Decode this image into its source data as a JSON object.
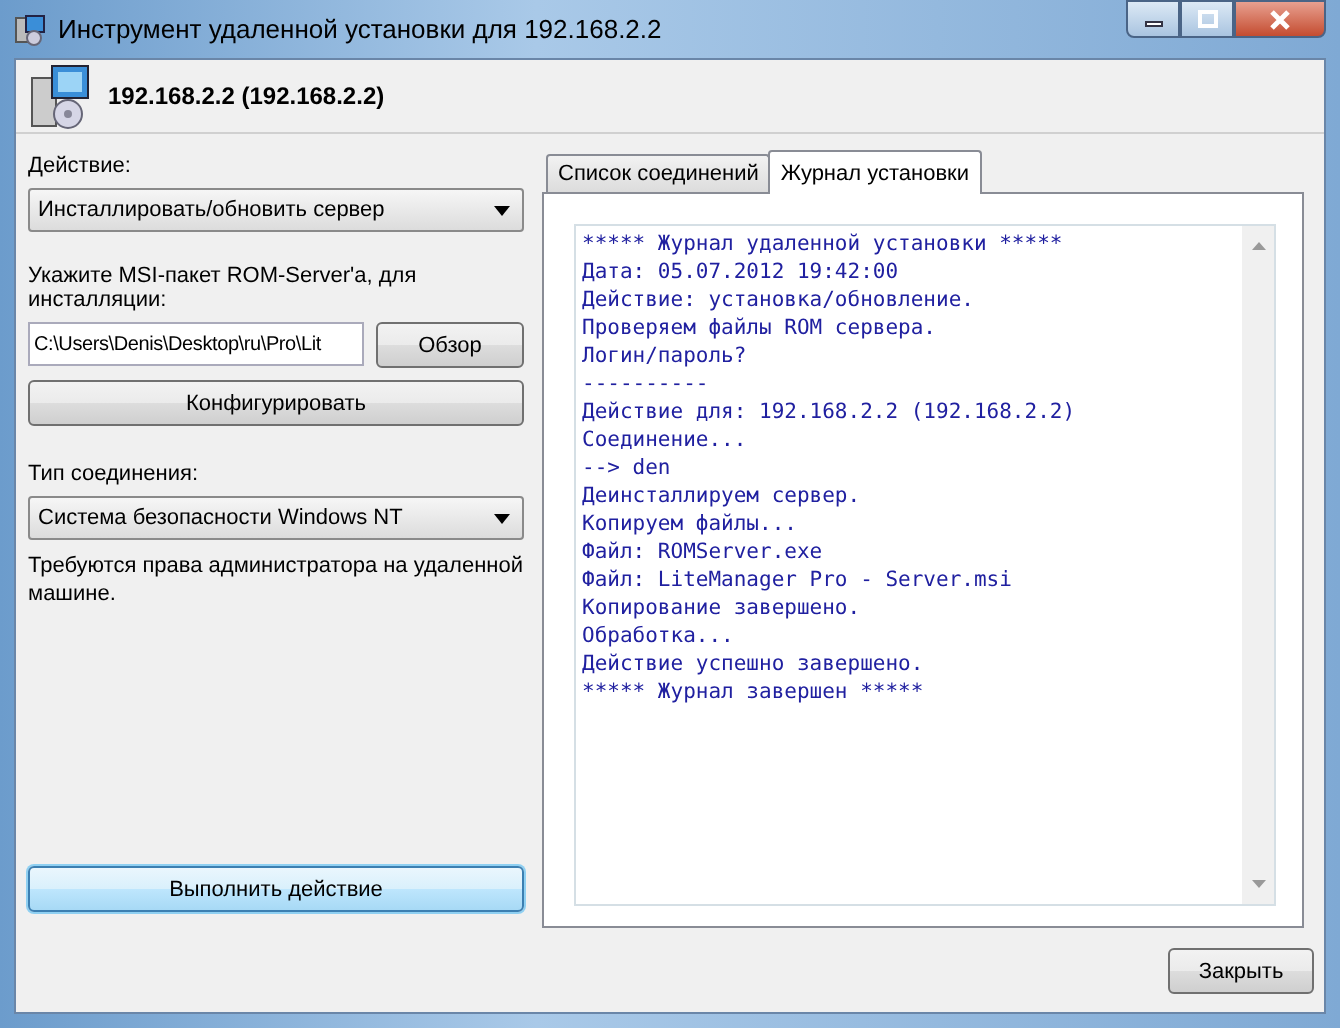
{
  "window": {
    "title": "Инструмент удаленной установки для 192.168.2.2"
  },
  "header": {
    "host": "192.168.2.2 (192.168.2.2)"
  },
  "action": {
    "label": "Действие:",
    "value": "Инсталлировать/обновить сервер"
  },
  "msi": {
    "label": "Укажите MSI-пакет ROM-Server'а, для инсталляции:",
    "path": "C:\\Users\\Denis\\Desktop\\ru\\Pro\\Lit",
    "browse": "Обзор"
  },
  "configure": "Конфигурировать",
  "connection": {
    "label": "Тип соединения:",
    "value": "Система безопасности Windows NT",
    "note": "Требуются права администратора на удаленной машине."
  },
  "run": {
    "label": "Выполнить действие",
    "focused": true
  },
  "tabs": [
    {
      "label": "Список соединений",
      "selected": false
    },
    {
      "label": "Журнал установки",
      "selected": true
    }
  ],
  "log": [
    "***** Журнал удаленной установки *****",
    "Дата: 05.07.2012 19:42:00",
    "Действие: установка/обновление.",
    "Проверяем файлы ROM сервера.",
    "Логин/пароль?",
    "----------",
    "Действие для: 192.168.2.2 (192.168.2.2)",
    "Соединение...",
    "--> den",
    "Деинсталлируем сервер.",
    "Копируем файлы...",
    "Файл: ROMServer.exe",
    "Файл: LiteManager Pro - Server.msi",
    "Копирование завершено.",
    "Обработка...",
    "Действие успешно завершено.",
    "***** Журнал завершен *****"
  ],
  "close": "Закрыть"
}
